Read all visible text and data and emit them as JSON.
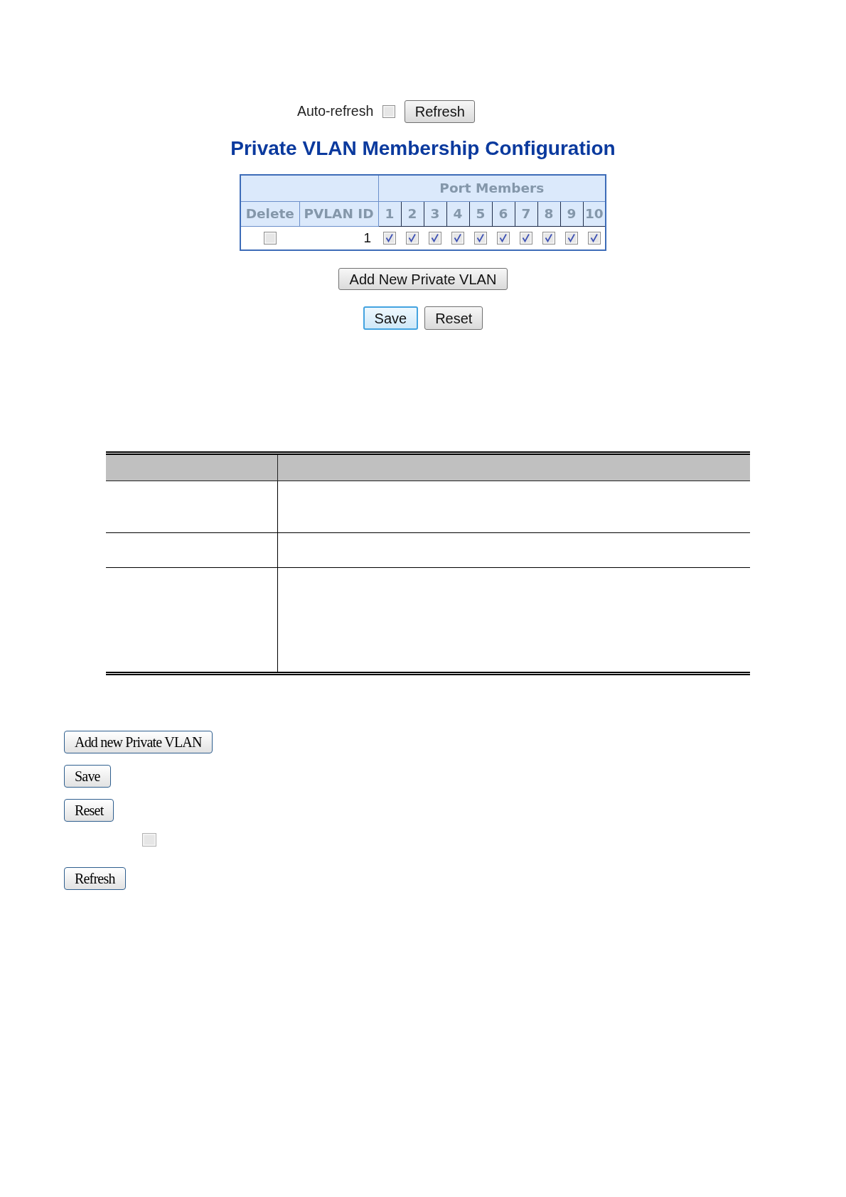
{
  "toolbar": {
    "auto_refresh": {
      "label": "Auto-refresh",
      "checked": false
    },
    "refresh_button": {
      "label": "Refresh"
    }
  },
  "title": "Private VLAN Membership Configuration",
  "table": {
    "group_header": "Port Members",
    "columns": [
      "Delete",
      "PVLAN ID"
    ],
    "ports": [
      "1",
      "2",
      "3",
      "4",
      "5",
      "6",
      "7",
      "8",
      "9",
      "10"
    ],
    "rows": [
      {
        "delete": false,
        "pvlan_id": "1",
        "members": [
          {
            "checked": true
          },
          {
            "checked": true
          },
          {
            "checked": true
          },
          {
            "checked": true
          },
          {
            "checked": true
          },
          {
            "checked": true
          },
          {
            "checked": true
          },
          {
            "checked": true
          },
          {
            "checked": true
          },
          {
            "checked": true
          }
        ]
      }
    ]
  },
  "add_button": {
    "label": "Add New Private VLAN"
  },
  "form_buttons": [
    {
      "label": "Save",
      "focused": true
    },
    {
      "label": "Reset",
      "focused": false
    }
  ],
  "legend": [
    {
      "kind": "button",
      "label": "Add new Private VLAN"
    },
    {
      "kind": "button",
      "label": "Save"
    },
    {
      "kind": "button",
      "label": "Reset"
    },
    {
      "kind": "checkbox",
      "checked": false
    },
    {
      "kind": "button",
      "label": "Refresh"
    }
  ]
}
